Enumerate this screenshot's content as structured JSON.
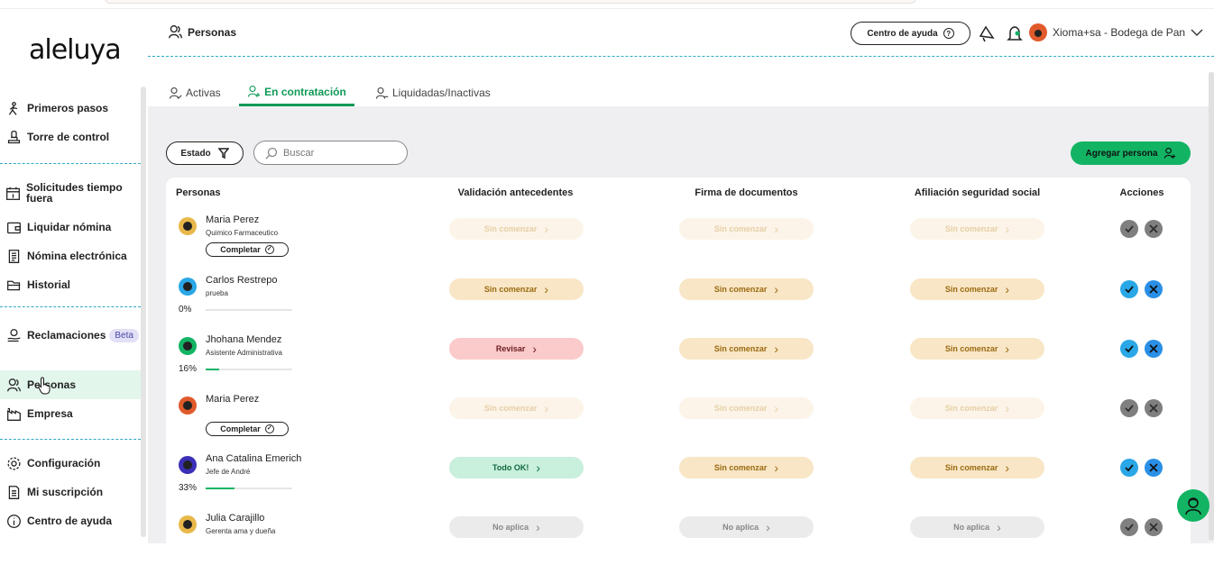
{
  "app": {
    "logo": "aleluya",
    "page_title": "Personas"
  },
  "header": {
    "help_label": "Centro de ayuda",
    "company": "Xioma+sa - Bodega de Pan",
    "avatar_color": "#e05a2b"
  },
  "sidebar": {
    "items": [
      {
        "label": "Primeros pasos",
        "icon": "route-icon"
      },
      {
        "label": "Torre de control",
        "icon": "stamp-icon"
      },
      {
        "label": "Solicitudes tiempo fuera",
        "icon": "calendar-icon"
      },
      {
        "label": "Liquidar nómina",
        "icon": "wallet-icon"
      },
      {
        "label": "Nómina electrónica",
        "icon": "receipt-icon"
      },
      {
        "label": "Historial",
        "icon": "folder-icon"
      },
      {
        "label": "Reclamaciones",
        "icon": "hand-coin-icon",
        "badge": "Beta"
      },
      {
        "label": "Personas",
        "icon": "people-icon",
        "active": true
      },
      {
        "label": "Empresa",
        "icon": "factory-icon"
      },
      {
        "label": "Configuración",
        "icon": "gear-icon"
      },
      {
        "label": "Mi suscripción",
        "icon": "document-icon"
      },
      {
        "label": "Centro de ayuda",
        "icon": "info-icon"
      }
    ]
  },
  "tabs": [
    {
      "label": "Activas"
    },
    {
      "label": "En contratación",
      "active": true
    },
    {
      "label": "Liquidadas/Inactivas"
    }
  ],
  "toolbar": {
    "filter_label": "Estado",
    "search_placeholder": "Buscar",
    "add_label": "Agregar persona"
  },
  "table": {
    "columns": [
      "Personas",
      "Validación antecedentes",
      "Firma de documentos",
      "Afiliación seguridad social",
      "Acciones"
    ],
    "rows": [
      {
        "name": "Maria Perez",
        "role": "Quimico Farmaceutico",
        "complete": "Completar",
        "avatar_color": "#e8b84a",
        "statuses": [
          {
            "label": "Sin comenzar",
            "kind": "faded"
          },
          {
            "label": "Sin comenzar",
            "kind": "faded"
          },
          {
            "label": "Sin comenzar",
            "kind": "faded"
          }
        ],
        "actions_enabled": false
      },
      {
        "name": "Carlos Restrepo",
        "role": "prueba",
        "percent": "0%",
        "progress": 0,
        "avatar_color": "#2aa7e6",
        "statuses": [
          {
            "label": "Sin comenzar",
            "kind": "pending"
          },
          {
            "label": "Sin comenzar",
            "kind": "pending"
          },
          {
            "label": "Sin comenzar",
            "kind": "pending"
          }
        ],
        "actions_enabled": true
      },
      {
        "name": "Jhohana Mendez",
        "role": "Asistente Administrativa",
        "percent": "16%",
        "progress": 16,
        "avatar_color": "#12b464",
        "statuses": [
          {
            "label": "Revisar",
            "kind": "review"
          },
          {
            "label": "Sin comenzar",
            "kind": "pending"
          },
          {
            "label": "Sin comenzar",
            "kind": "pending"
          }
        ],
        "actions_enabled": true
      },
      {
        "name": "Maria Perez",
        "role": "",
        "complete": "Completar",
        "avatar_color": "#e05a2b",
        "statuses": [
          {
            "label": "Sin comenzar",
            "kind": "faded"
          },
          {
            "label": "Sin comenzar",
            "kind": "faded"
          },
          {
            "label": "Sin comenzar",
            "kind": "faded"
          }
        ],
        "actions_enabled": false
      },
      {
        "name": "Ana Catalina Emerich",
        "role": "Jefe de André",
        "percent": "33%",
        "progress": 33,
        "avatar_color": "#3b2fb8",
        "statuses": [
          {
            "label": "Todo OK!",
            "kind": "ok"
          },
          {
            "label": "Sin comenzar",
            "kind": "pending"
          },
          {
            "label": "Sin comenzar",
            "kind": "pending"
          }
        ],
        "actions_enabled": true
      },
      {
        "name": "Julia Carajillo",
        "role": "Gerenta ama y dueña",
        "avatar_color": "#e8b84a",
        "statuses": [
          {
            "label": "No aplica",
            "kind": "na"
          },
          {
            "label": "No aplica",
            "kind": "na"
          },
          {
            "label": "No aplica",
            "kind": "na"
          }
        ],
        "actions_enabled": false
      }
    ]
  }
}
